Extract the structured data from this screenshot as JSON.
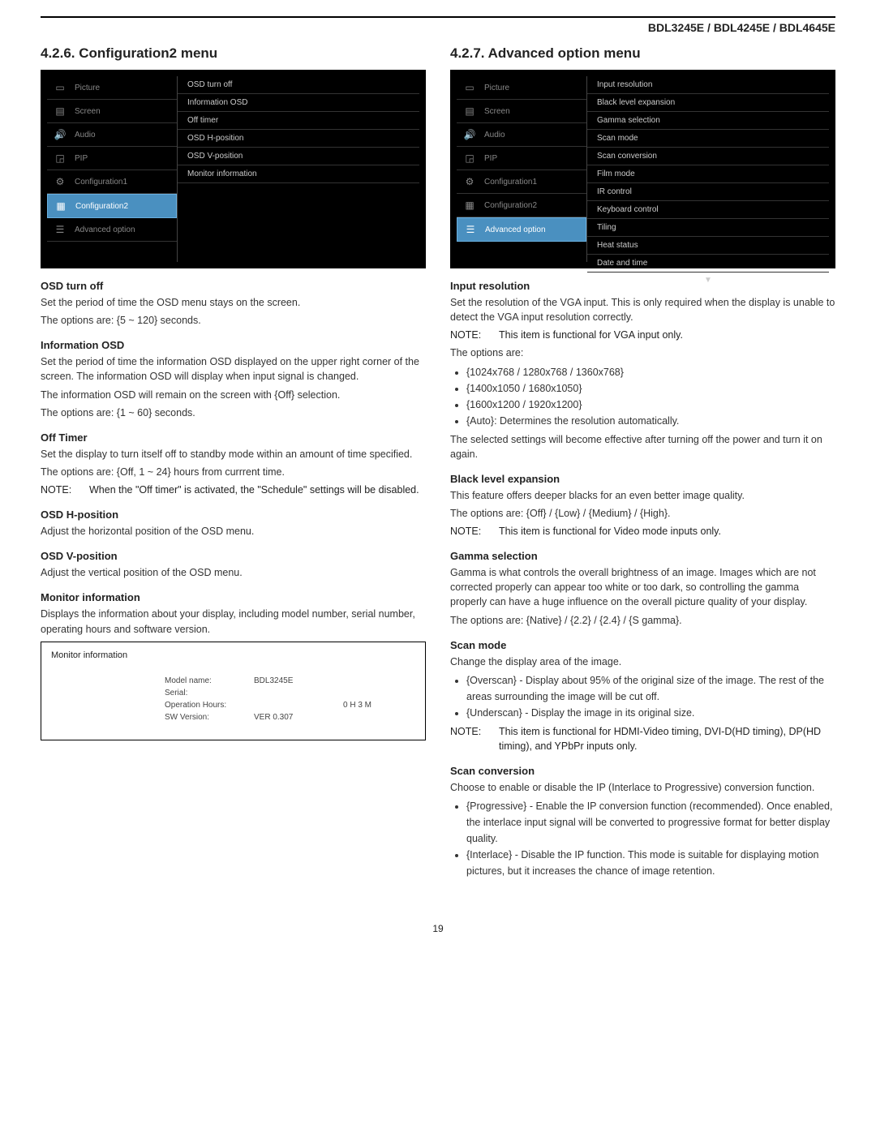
{
  "header": {
    "models": "BDL3245E / BDL4245E / BDL4645E"
  },
  "left": {
    "title": "4.2.6.  Configuration2 menu",
    "osd_left": [
      {
        "icon": "picture-icon",
        "label": "Picture"
      },
      {
        "icon": "screen-icon",
        "label": "Screen"
      },
      {
        "icon": "audio-icon",
        "label": "Audio"
      },
      {
        "icon": "pip-icon",
        "label": "PIP"
      },
      {
        "icon": "gear-icon",
        "label": "Configuration1"
      },
      {
        "icon": "config2-icon",
        "label": "Configuration2"
      },
      {
        "icon": "advanced-icon",
        "label": "Advanced option"
      }
    ],
    "osd_right": [
      "OSD turn off",
      "Information OSD",
      "Off timer",
      "OSD H-position",
      "OSD V-position",
      "Monitor information"
    ],
    "osd_turnoff": {
      "title": "OSD turn off",
      "p1": "Set the period of time the OSD menu stays on the screen.",
      "p2": "The options are: {5 ~ 120} seconds."
    },
    "info_osd": {
      "title": "Information OSD",
      "p1": "Set the period of time the information OSD displayed on the upper right corner of the screen. The information OSD will display when input signal is changed.",
      "p2": "The information OSD will remain on the screen with {Off} selection.",
      "p3": "The options are: {1 ~ 60} seconds."
    },
    "off_timer": {
      "title": "Off Timer",
      "p1": "Set the display to turn itself off to standby mode within an amount of time specified.",
      "p2": "The options are: {Off, 1 ~ 24} hours from currrent time.",
      "note_label": "NOTE:",
      "note": "When the \"Off timer\" is activated, the \"Schedule\" settings will be disabled."
    },
    "osd_h": {
      "title": "OSD H-position",
      "p1": "Adjust the horizontal position of the OSD menu."
    },
    "osd_v": {
      "title": "OSD V-position",
      "p1": "Adjust the vertical position of the OSD menu."
    },
    "mon_info": {
      "title": "Monitor information",
      "p1": "Displays the information about your display, including model number, serial number, operating hours and software version.",
      "box_title": "Monitor information",
      "rows": [
        {
          "label": "Model name:",
          "val": "BDL3245E",
          "extra": ""
        },
        {
          "label": "Serial:",
          "val": "",
          "extra": ""
        },
        {
          "label": "Operation Hours:",
          "val": "",
          "extra": "0 H    3 M"
        },
        {
          "label": "SW Version:",
          "val": "VER 0.307",
          "extra": ""
        }
      ]
    }
  },
  "right": {
    "title": "4.2.7.  Advanced option menu",
    "osd_left": [
      {
        "icon": "picture-icon",
        "label": "Picture"
      },
      {
        "icon": "screen-icon",
        "label": "Screen"
      },
      {
        "icon": "audio-icon",
        "label": "Audio"
      },
      {
        "icon": "pip-icon",
        "label": "PIP"
      },
      {
        "icon": "gear-icon",
        "label": "Configuration1"
      },
      {
        "icon": "config2-icon",
        "label": "Configuration2"
      },
      {
        "icon": "advanced-icon",
        "label": "Advanced option"
      }
    ],
    "osd_right": [
      "Input resolution",
      "Black level expansion",
      "Gamma selection",
      "Scan mode",
      "Scan conversion",
      "Film mode",
      "IR control",
      "Keyboard control",
      "Tiling",
      "Heat status",
      "Date and time"
    ],
    "input_res": {
      "title": "Input resolution",
      "p1": "Set the resolution of the VGA input. This is only required when the display is unable to detect the VGA input resolution correctly.",
      "note_label": "NOTE:",
      "note": "This item is functional for VGA input only.",
      "p2": "The options are:",
      "opts": [
        "{1024x768 / 1280x768 / 1360x768}",
        "{1400x1050 / 1680x1050}",
        "{1600x1200 / 1920x1200}",
        "{Auto}: Determines the resolution automatically."
      ],
      "p3": "The selected settings will become effective after turning off the power and turn it on again."
    },
    "black": {
      "title": "Black level expansion",
      "p1": "This feature offers deeper blacks for an even better image quality.",
      "p2": "The options are: {Off} / {Low} / {Medium} / {High}.",
      "note_label": "NOTE:",
      "note": "This item is functional for Video mode inputs only."
    },
    "gamma": {
      "title": "Gamma selection",
      "p1": "Gamma is what controls the overall brightness of an image. Images which are not corrected  properly can appear too white or too dark, so controlling the gamma properly can have a huge influence on the overall picture quality of your display.",
      "p2": "The options are: {Native} / {2.2} / {2.4} / {S gamma}."
    },
    "scan_mode": {
      "title": "Scan mode",
      "p1": "Change the display area of the image.",
      "opts": [
        "{Overscan} - Display about 95% of the original size of the image. The rest of the areas surrounding the image will be cut off.",
        "{Underscan} - Display the image in its original size."
      ],
      "note_label": "NOTE:",
      "note": "This item is functional for HDMI-Video timing, DVI-D(HD timing), DP(HD timing), and YPbPr inputs only."
    },
    "scan_conv": {
      "title": "Scan conversion",
      "p1": "Choose to enable or disable the IP (Interlace to Progressive) conversion function.",
      "opts": [
        "{Progressive} - Enable the IP conversion function (recommended). Once enabled, the interlace input signal will be converted to progressive format for better display quality.",
        "{Interlace} - Disable the IP function. This mode is suitable for displaying motion pictures, but it increases the chance of image retention."
      ]
    }
  },
  "page_num": "19"
}
